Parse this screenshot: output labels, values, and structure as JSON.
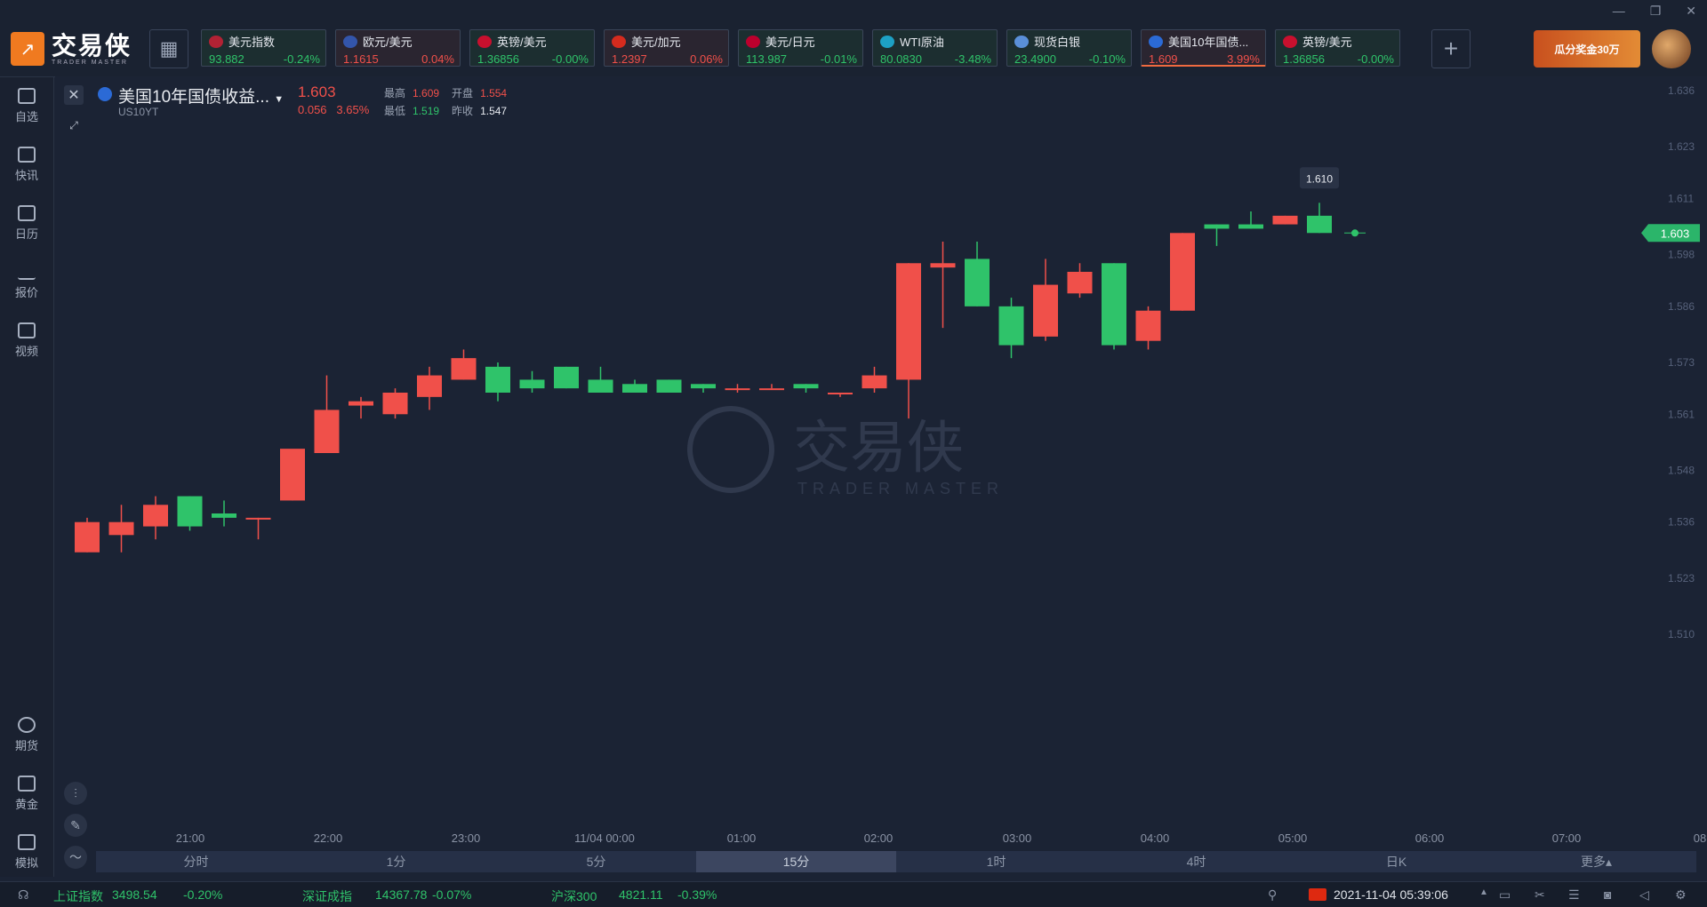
{
  "window_controls": [
    "—",
    "❐",
    "✕"
  ],
  "logo": {
    "cn": "交易侠",
    "en": "TRADER MASTER"
  },
  "tickers": [
    {
      "name": "美元指数",
      "price": "93.882",
      "change": "-0.24%",
      "dir": "down",
      "flag_color": "#b22234"
    },
    {
      "name": "欧元/美元",
      "price": "1.1615",
      "change": "0.04%",
      "dir": "up",
      "flag_color": "#3355aa"
    },
    {
      "name": "英镑/美元",
      "price": "1.36856",
      "change": "-0.00%",
      "dir": "down",
      "flag_color": "#c8102e"
    },
    {
      "name": "美元/加元",
      "price": "1.2397",
      "change": "0.06%",
      "dir": "up",
      "flag_color": "#d52b1e"
    },
    {
      "name": "美元/日元",
      "price": "113.987",
      "change": "-0.01%",
      "dir": "down",
      "flag_color": "#bc002d"
    },
    {
      "name": "WTI原油",
      "price": "80.0830",
      "change": "-3.48%",
      "dir": "down",
      "flag_color": "#1da0c4"
    },
    {
      "name": "现货白银",
      "price": "23.4900",
      "change": "-0.10%",
      "dir": "down",
      "flag_color": "#5a8fd8"
    },
    {
      "name": "美国10年国债...",
      "price": "1.609",
      "change": "3.99%",
      "dir": "up",
      "flag_color": "#2b6ad6",
      "active": true
    },
    {
      "name": "英镑/美元",
      "price": "1.36856",
      "change": "-0.00%",
      "dir": "down",
      "flag_color": "#c8102e"
    }
  ],
  "promo": {
    "text": "瓜分奖金30万"
  },
  "sidebar": {
    "top": [
      {
        "label": "自选"
      },
      {
        "label": "快讯"
      },
      {
        "label": "日历"
      },
      {
        "label": "报价"
      },
      {
        "label": "视频"
      }
    ],
    "bottom": [
      {
        "label": "期货"
      },
      {
        "label": "黄金"
      },
      {
        "label": "模拟"
      }
    ]
  },
  "instrument": {
    "name": "美国10年国债收益...",
    "code": "US10YT",
    "price": "1.603",
    "change": "0.056",
    "change_pct": "3.65%",
    "high_label": "最高",
    "high": "1.609",
    "open_label": "开盘",
    "open": "1.554",
    "low_label": "最低",
    "low": "1.519",
    "prev_label": "昨收",
    "prev": "1.547"
  },
  "watermark": {
    "cn": "交易侠",
    "en": "TRADER MASTER"
  },
  "chart_data": {
    "type": "candlestick",
    "interval": "15分",
    "y_ticks": [
      "1.636",
      "1.623",
      "1.611",
      "1.598",
      "1.586",
      "1.573",
      "1.561",
      "1.548",
      "1.536",
      "1.523",
      "1.510"
    ],
    "x_ticks": [
      "21:00",
      "22:00",
      "23:00",
      "11/04 00:00",
      "01:00",
      "02:00",
      "03:00",
      "04:00",
      "05:00",
      "06:00",
      "07:00",
      "08"
    ],
    "current_price_label": "1.603",
    "high_marker_label": "1.610",
    "candles": [
      {
        "o": 1.529,
        "h": 1.537,
        "l": 1.529,
        "c": 1.536
      },
      {
        "o": 1.533,
        "h": 1.54,
        "l": 1.529,
        "c": 1.536
      },
      {
        "o": 1.535,
        "h": 1.542,
        "l": 1.532,
        "c": 1.54
      },
      {
        "o": 1.542,
        "h": 1.542,
        "l": 1.534,
        "c": 1.535
      },
      {
        "o": 1.538,
        "h": 1.541,
        "l": 1.535,
        "c": 1.537
      },
      {
        "o": 1.537,
        "h": 1.537,
        "l": 1.532,
        "c": 1.537
      },
      {
        "o": 1.541,
        "h": 1.547,
        "l": 1.541,
        "c": 1.553
      },
      {
        "o": 1.552,
        "h": 1.57,
        "l": 1.552,
        "c": 1.562
      },
      {
        "o": 1.563,
        "h": 1.565,
        "l": 1.56,
        "c": 1.564
      },
      {
        "o": 1.561,
        "h": 1.567,
        "l": 1.56,
        "c": 1.566
      },
      {
        "o": 1.565,
        "h": 1.572,
        "l": 1.562,
        "c": 1.57
      },
      {
        "o": 1.569,
        "h": 1.576,
        "l": 1.569,
        "c": 1.574
      },
      {
        "o": 1.572,
        "h": 1.573,
        "l": 1.564,
        "c": 1.566
      },
      {
        "o": 1.569,
        "h": 1.571,
        "l": 1.566,
        "c": 1.567
      },
      {
        "o": 1.572,
        "h": 1.572,
        "l": 1.567,
        "c": 1.567
      },
      {
        "o": 1.569,
        "h": 1.572,
        "l": 1.566,
        "c": 1.566
      },
      {
        "o": 1.568,
        "h": 1.569,
        "l": 1.566,
        "c": 1.566
      },
      {
        "o": 1.569,
        "h": 1.569,
        "l": 1.566,
        "c": 1.566
      },
      {
        "o": 1.568,
        "h": 1.568,
        "l": 1.566,
        "c": 1.567
      },
      {
        "o": 1.567,
        "h": 1.568,
        "l": 1.566,
        "c": 1.567
      },
      {
        "o": 1.567,
        "h": 1.568,
        "l": 1.567,
        "c": 1.567
      },
      {
        "o": 1.568,
        "h": 1.568,
        "l": 1.566,
        "c": 1.567
      },
      {
        "o": 1.566,
        "h": 1.566,
        "l": 1.565,
        "c": 1.566
      },
      {
        "o": 1.567,
        "h": 1.572,
        "l": 1.566,
        "c": 1.57
      },
      {
        "o": 1.569,
        "h": 1.596,
        "l": 1.56,
        "c": 1.596
      },
      {
        "o": 1.595,
        "h": 1.601,
        "l": 1.581,
        "c": 1.596
      },
      {
        "o": 1.597,
        "h": 1.601,
        "l": 1.586,
        "c": 1.586
      },
      {
        "o": 1.586,
        "h": 1.588,
        "l": 1.574,
        "c": 1.577
      },
      {
        "o": 1.579,
        "h": 1.597,
        "l": 1.578,
        "c": 1.591
      },
      {
        "o": 1.589,
        "h": 1.596,
        "l": 1.588,
        "c": 1.594
      },
      {
        "o": 1.596,
        "h": 1.596,
        "l": 1.576,
        "c": 1.577
      },
      {
        "o": 1.578,
        "h": 1.586,
        "l": 1.576,
        "c": 1.585
      },
      {
        "o": 1.585,
        "h": 1.603,
        "l": 1.585,
        "c": 1.603
      },
      {
        "o": 1.605,
        "h": 1.605,
        "l": 1.6,
        "c": 1.604
      },
      {
        "o": 1.605,
        "h": 1.608,
        "l": 1.604,
        "c": 1.604
      },
      {
        "o": 1.605,
        "h": 1.607,
        "l": 1.605,
        "c": 1.607
      },
      {
        "o": 1.607,
        "h": 1.61,
        "l": 1.603,
        "c": 1.603
      }
    ],
    "up_color": "#f0504a",
    "down_color": "#2fc36a"
  },
  "timeframes": [
    {
      "label": "分时"
    },
    {
      "label": "1分"
    },
    {
      "label": "5分"
    },
    {
      "label": "15分",
      "selected": true
    },
    {
      "label": "1时"
    },
    {
      "label": "4时"
    },
    {
      "label": "日K"
    },
    {
      "label": "更多▴"
    }
  ],
  "status_bar": {
    "indices": [
      {
        "name": "上证指数",
        "value": "3498.54",
        "change": "-0.20%"
      },
      {
        "name": "深证成指",
        "value": "14367.78",
        "change": "-0.07%"
      },
      {
        "name": "沪深300",
        "value": "4821.11",
        "change": "-0.39%"
      }
    ],
    "datetime": "2021-11-04 05:39:06"
  }
}
